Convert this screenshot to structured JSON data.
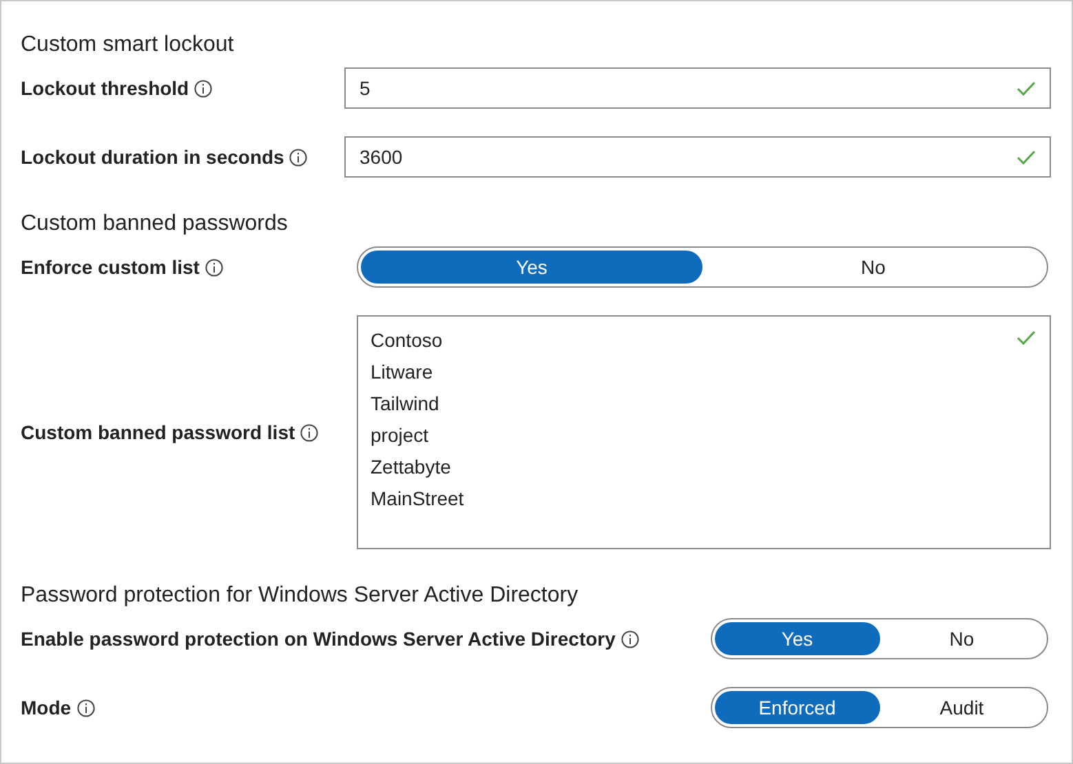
{
  "sections": [
    {
      "heading": "Custom smart lockout",
      "fields": [
        {
          "kind": "input",
          "label": "Lockout threshold",
          "value": "5",
          "valid": true
        },
        {
          "kind": "input",
          "label": "Lockout duration in seconds",
          "value": "3600",
          "valid": true
        }
      ]
    },
    {
      "heading": "Custom banned passwords",
      "fields": [
        {
          "kind": "toggle",
          "label": "Enforce custom list",
          "options": [
            {
              "label": "Yes",
              "selected": true
            },
            {
              "label": "No",
              "selected": false
            }
          ]
        },
        {
          "kind": "textarea",
          "label": "Custom banned password list",
          "lines": [
            "Contoso",
            "Litware",
            "Tailwind",
            "project",
            "Zettabyte",
            "MainStreet"
          ],
          "valid": true
        }
      ]
    },
    {
      "heading": "Password protection for Windows Server Active Directory",
      "fields": [
        {
          "kind": "toggle",
          "narrow": true,
          "label": "Enable password protection on Windows Server Active Directory",
          "options": [
            {
              "label": "Yes",
              "selected": true
            },
            {
              "label": "No",
              "selected": false
            }
          ]
        },
        {
          "kind": "toggle",
          "narrow": true,
          "label": "Mode",
          "options": [
            {
              "label": "Enforced",
              "selected": true
            },
            {
              "label": "Audit",
              "selected": false
            }
          ]
        }
      ]
    }
  ]
}
